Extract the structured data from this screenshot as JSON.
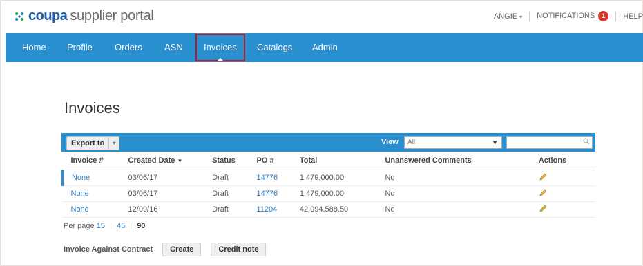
{
  "header": {
    "brand": "coupa",
    "portal_name": "supplier portal",
    "user_name": "ANGIE",
    "notifications_label": "NOTIFICATIONS",
    "notifications_count": "1",
    "help_label": "HELP"
  },
  "nav": {
    "items": [
      "Home",
      "Profile",
      "Orders",
      "ASN",
      "Invoices",
      "Catalogs",
      "Admin"
    ],
    "active": "Invoices"
  },
  "page": {
    "title": "Invoices"
  },
  "toolbar": {
    "export_label": "Export to",
    "view_label": "View",
    "view_value": "All"
  },
  "table": {
    "columns": [
      "Invoice #",
      "Created Date",
      "Status",
      "PO #",
      "Total",
      "Unanswered Comments",
      "Actions"
    ],
    "rows": [
      {
        "invoice": "None",
        "date": "03/06/17",
        "status": "Draft",
        "po": "14776",
        "total": "1,479,000.00",
        "comments": "No"
      },
      {
        "invoice": "None",
        "date": "03/06/17",
        "status": "Draft",
        "po": "14776",
        "total": "1,479,000.00",
        "comments": "No"
      },
      {
        "invoice": "None",
        "date": "12/09/16",
        "status": "Draft",
        "po": "11204",
        "total": "42,094,588.50",
        "comments": "No"
      }
    ]
  },
  "pager": {
    "label": "Per page",
    "options": [
      "15",
      "45",
      "90"
    ],
    "current": "90"
  },
  "bottom": {
    "label": "Invoice Against Contract",
    "create_label": "Create",
    "credit_label": "Credit note"
  },
  "colors": {
    "nav": "#2a8fcf",
    "brand": "#1e5ea8",
    "active_outline": "#b31c24",
    "badge": "#d9382a"
  }
}
